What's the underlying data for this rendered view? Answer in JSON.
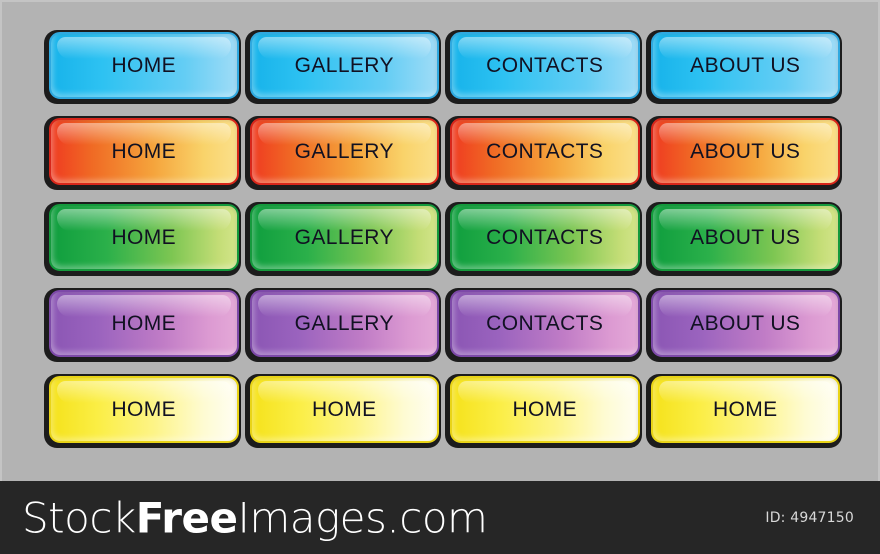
{
  "canvas": {
    "background_color": "#b3b3b3",
    "border_color": "#c4c4c4"
  },
  "button_grid": {
    "rows": [
      {
        "name": "blue-row",
        "color_name": "blue",
        "gradient_from": "#17b3ea",
        "gradient_to": "#9fdcf7",
        "border_color": "#2fa9e0",
        "buttons": [
          {
            "label": "HOME"
          },
          {
            "label": "GALLERY"
          },
          {
            "label": "CONTACTS"
          },
          {
            "label": "ABOUT US"
          }
        ]
      },
      {
        "name": "orange-row",
        "color_name": "orange",
        "gradient_from": "#ef3b21",
        "gradient_to": "#fbe08b",
        "border_color": "#d8261a",
        "buttons": [
          {
            "label": "HOME"
          },
          {
            "label": "GALLERY"
          },
          {
            "label": "CONTACTS"
          },
          {
            "label": "ABOUT US"
          }
        ]
      },
      {
        "name": "green-row",
        "color_name": "green",
        "gradient_from": "#0f9e3e",
        "gradient_to": "#d4e58a",
        "border_color": "#149a3c",
        "buttons": [
          {
            "label": "HOME"
          },
          {
            "label": "GALLERY"
          },
          {
            "label": "CONTACTS"
          },
          {
            "label": "ABOUT US"
          }
        ]
      },
      {
        "name": "purple-row",
        "color_name": "purple",
        "gradient_from": "#8b56b4",
        "gradient_to": "#e4a9d8",
        "border_color": "#7d49a8",
        "buttons": [
          {
            "label": "HOME"
          },
          {
            "label": "GALLERY"
          },
          {
            "label": "CONTACTS"
          },
          {
            "label": "ABOUT US"
          }
        ]
      },
      {
        "name": "yellow-row",
        "color_name": "yellow",
        "gradient_from": "#f5e21b",
        "gradient_to": "#fffef3",
        "border_color": "#e9d417",
        "buttons": [
          {
            "label": "HOME"
          },
          {
            "label": "HOME"
          },
          {
            "label": "HOME"
          },
          {
            "label": "HOME"
          }
        ]
      }
    ]
  },
  "footer": {
    "background_color": "#262626",
    "wordmark_part1": "Stock",
    "wordmark_part2": "Free",
    "wordmark_part3": "Images.com",
    "id_text": "ID: 4947150"
  }
}
